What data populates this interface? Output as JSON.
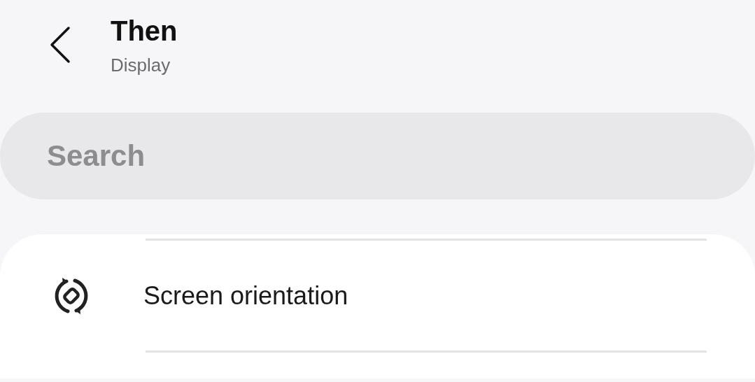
{
  "header": {
    "title": "Then",
    "subtitle": "Display"
  },
  "search": {
    "placeholder": "Search"
  },
  "settings": [
    {
      "label": "Screen orientation"
    }
  ]
}
